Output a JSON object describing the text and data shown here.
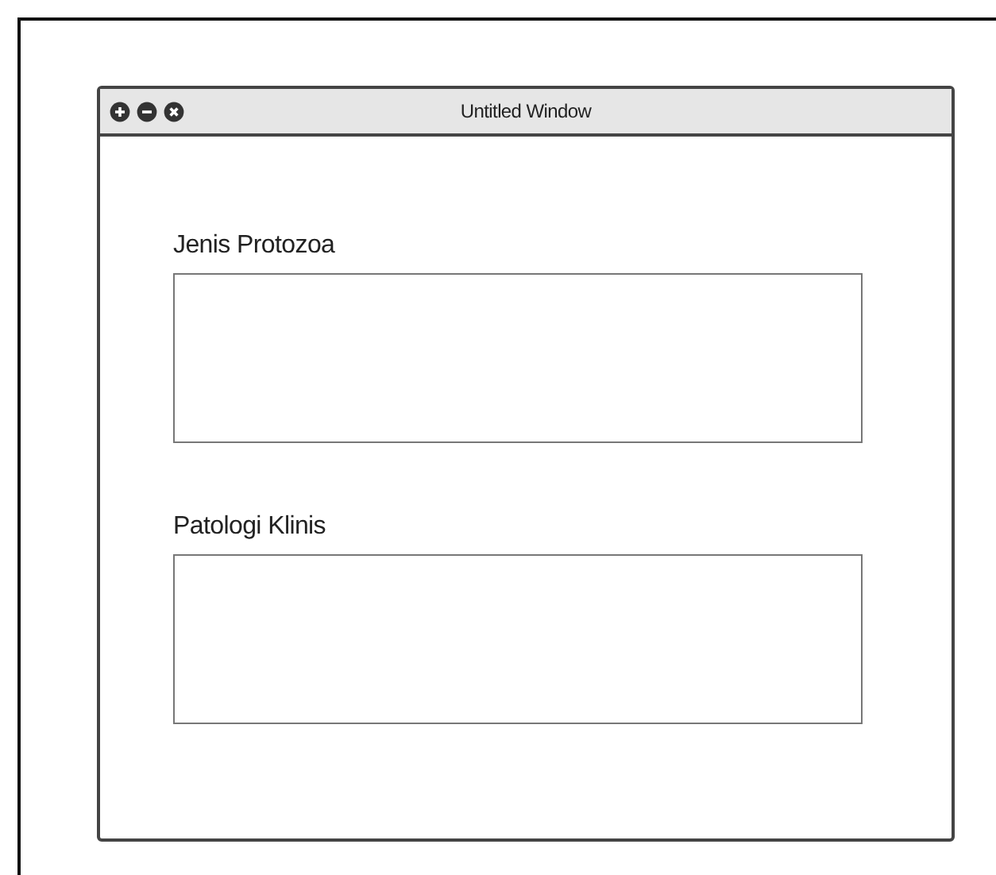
{
  "window": {
    "title": "Untitled Window"
  },
  "fields": [
    {
      "label": "Jenis Protozoa"
    },
    {
      "label": "Patologi Klinis"
    }
  ]
}
